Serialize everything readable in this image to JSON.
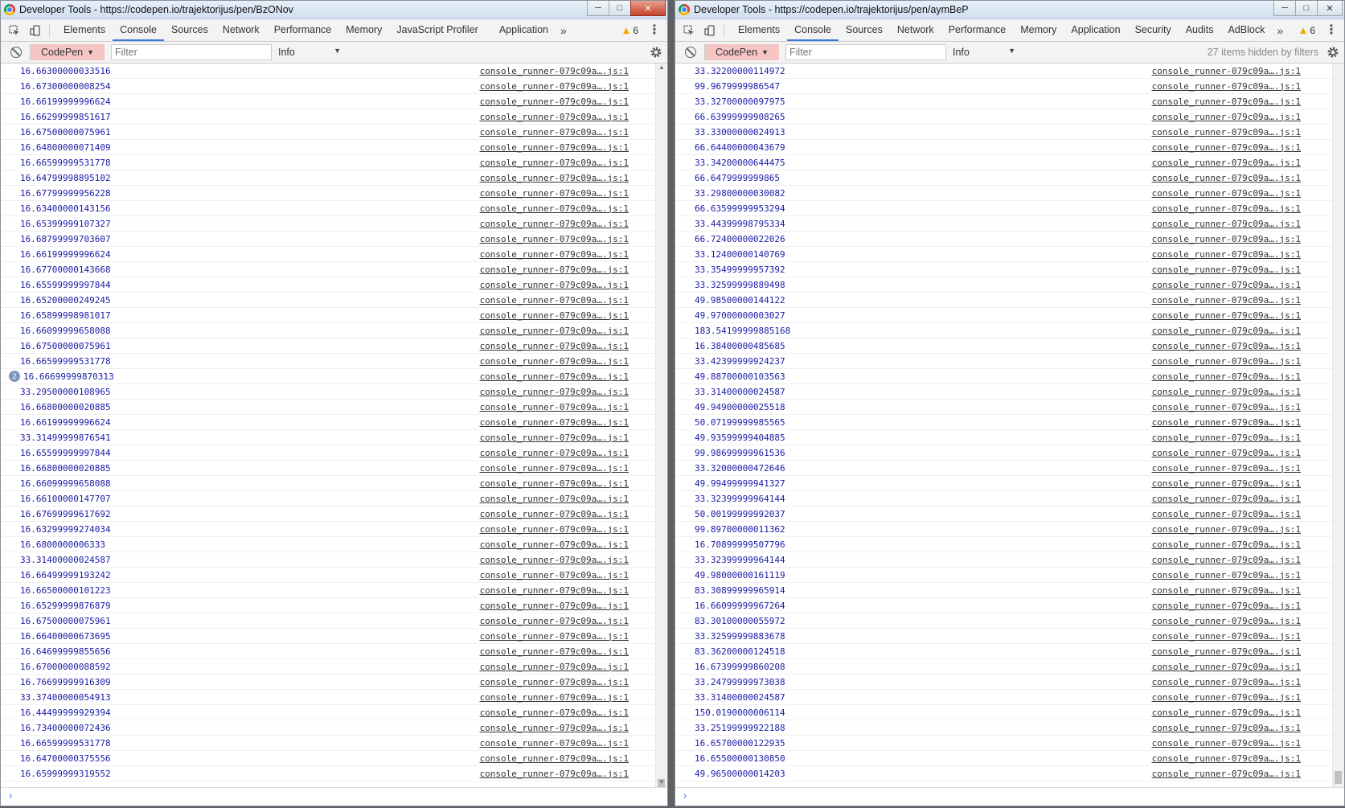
{
  "left": {
    "title": "Developer Tools - https://codepen.io/trajektorijus/pen/BzONov",
    "tabs": [
      "Elements",
      "Console",
      "Sources",
      "Network",
      "Performance",
      "Memory",
      "JavaScript Profiler",
      "Application"
    ],
    "active_tab": "Console",
    "more_tabs": "»",
    "warnings": "6",
    "context": "CodePen",
    "filter_placeholder": "Filter",
    "level": "Info",
    "hidden_note": "",
    "source": "console_runner-079c09a….js:1",
    "group_count": "2",
    "logs": [
      "16.66300000033516",
      "16.67300000008254",
      "16.66199999996624",
      "16.66299999851617",
      "16.67500000075961",
      "16.64800000071409",
      "16.66599999531778",
      "16.64799998895102",
      "16.67799999956228",
      "16.63400000143156",
      "16.65399999107327",
      "16.68799999703607",
      "16.66199999996624",
      "16.67700000143668",
      "16.65599999997844",
      "16.65200000249245",
      "16.65899998981017",
      "16.66099999658088",
      "16.67500000075961",
      "16.66599999531778",
      "16.66699999870313",
      "33.29500000108965",
      "16.66800000020885",
      "16.66199999996624",
      "33.31499999876541",
      "16.65599999997844",
      "16.66800000020885",
      "16.66099999658088",
      "16.66100000147707",
      "16.67699999617692",
      "16.63299999274034",
      "16.6800000006333",
      "33.31400000024587",
      "16.66499999193242",
      "16.66500000101223",
      "16.65299999876879",
      "16.67500000075961",
      "16.66400000673695",
      "16.64699999855656",
      "16.67000000088592",
      "16.76699999916309",
      "33.37400000054913",
      "16.44499999929394",
      "16.73400000072436",
      "16.66599999531778",
      "16.64700000375556",
      "16.65999999319552"
    ]
  },
  "right": {
    "title": "Developer Tools - https://codepen.io/trajektorijus/pen/aymBeP",
    "tabs": [
      "Elements",
      "Console",
      "Sources",
      "Network",
      "Performance",
      "Memory",
      "Application",
      "Security",
      "Audits",
      "AdBlock"
    ],
    "active_tab": "Console",
    "more_tabs": "»",
    "warnings": "6",
    "context": "CodePen",
    "filter_placeholder": "Filter",
    "level": "Info",
    "hidden_note": "27 items hidden by filters",
    "source": "console_runner-079c09a….js:1",
    "logs": [
      "33.32200000114972",
      "99.9679999986547",
      "33.32700000097975",
      "66.63999999908265",
      "33.33000000024913",
      "66.64400000043679",
      "33.34200000644475",
      "66.6479999999865",
      "33.29800000030082",
      "66.63599999953294",
      "33.44399998795334",
      "66.72400000022026",
      "33.12400000140769",
      "33.35499999957392",
      "33.32599999889498",
      "49.98500000144122",
      "49.97000000003027",
      "183.54199999885168",
      "16.38400000485685",
      "33.42399999924237",
      "49.88700000103563",
      "33.31400000024587",
      "49.94900000025518",
      "50.07199999985565",
      "49.93599999404885",
      "99.98699999961536",
      "33.32000000472646",
      "49.99499999941327",
      "33.32399999964144",
      "50.00199999992037",
      "99.89700000011362",
      "16.70899999507796",
      "33.32399999964144",
      "49.98000000161119",
      "83.30899999965914",
      "16.66099999967264",
      "83.30100000055972",
      "33.32599999883678",
      "83.36200000124518",
      "16.67399999860208",
      "33.24799999973038",
      "33.31400000024587",
      "150.0190000006114",
      "33.25199999922188",
      "16.65700000122935",
      "16.65500000130850",
      "49.96500000014203"
    ]
  }
}
